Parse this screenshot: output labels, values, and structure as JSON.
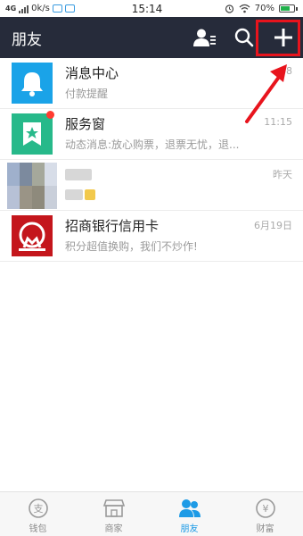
{
  "status_bar": {
    "network": "4G",
    "speed": "0k/s",
    "time": "15:14",
    "battery": "70%",
    "battery_level": 0.7
  },
  "header": {
    "title": "朋友"
  },
  "conversations": [
    {
      "name": "消息中心",
      "subtitle": "付款提醒",
      "time": "08",
      "icon": "bell-icon",
      "color": "#1aa3e8"
    },
    {
      "name": "服务窗",
      "subtitle": "动态消息:放心购票，退票无忧，退...",
      "time": "11:15",
      "icon": "star-bookmark-icon",
      "color": "#27b98a",
      "unread_dot": true
    },
    {
      "name": "",
      "subtitle": "",
      "time": "昨天",
      "icon": "contact-avatar",
      "color": "#b9c3d6"
    },
    {
      "name": "招商银行信用卡",
      "subtitle": "积分超值换购，我们不炒作!",
      "time": "6月19日",
      "icon": "cmb-logo-icon",
      "color": "#c4161c"
    }
  ],
  "tabs": [
    {
      "label": "钱包",
      "icon": "wallet-icon",
      "active": false
    },
    {
      "label": "商家",
      "icon": "shop-icon",
      "active": false
    },
    {
      "label": "朋友",
      "icon": "friends-icon",
      "active": true
    },
    {
      "label": "财富",
      "icon": "wealth-icon",
      "active": false
    }
  ],
  "colors": {
    "header_bg": "#262b3a",
    "accent": "#1e9be6",
    "annotation_red": "#e8141d"
  }
}
